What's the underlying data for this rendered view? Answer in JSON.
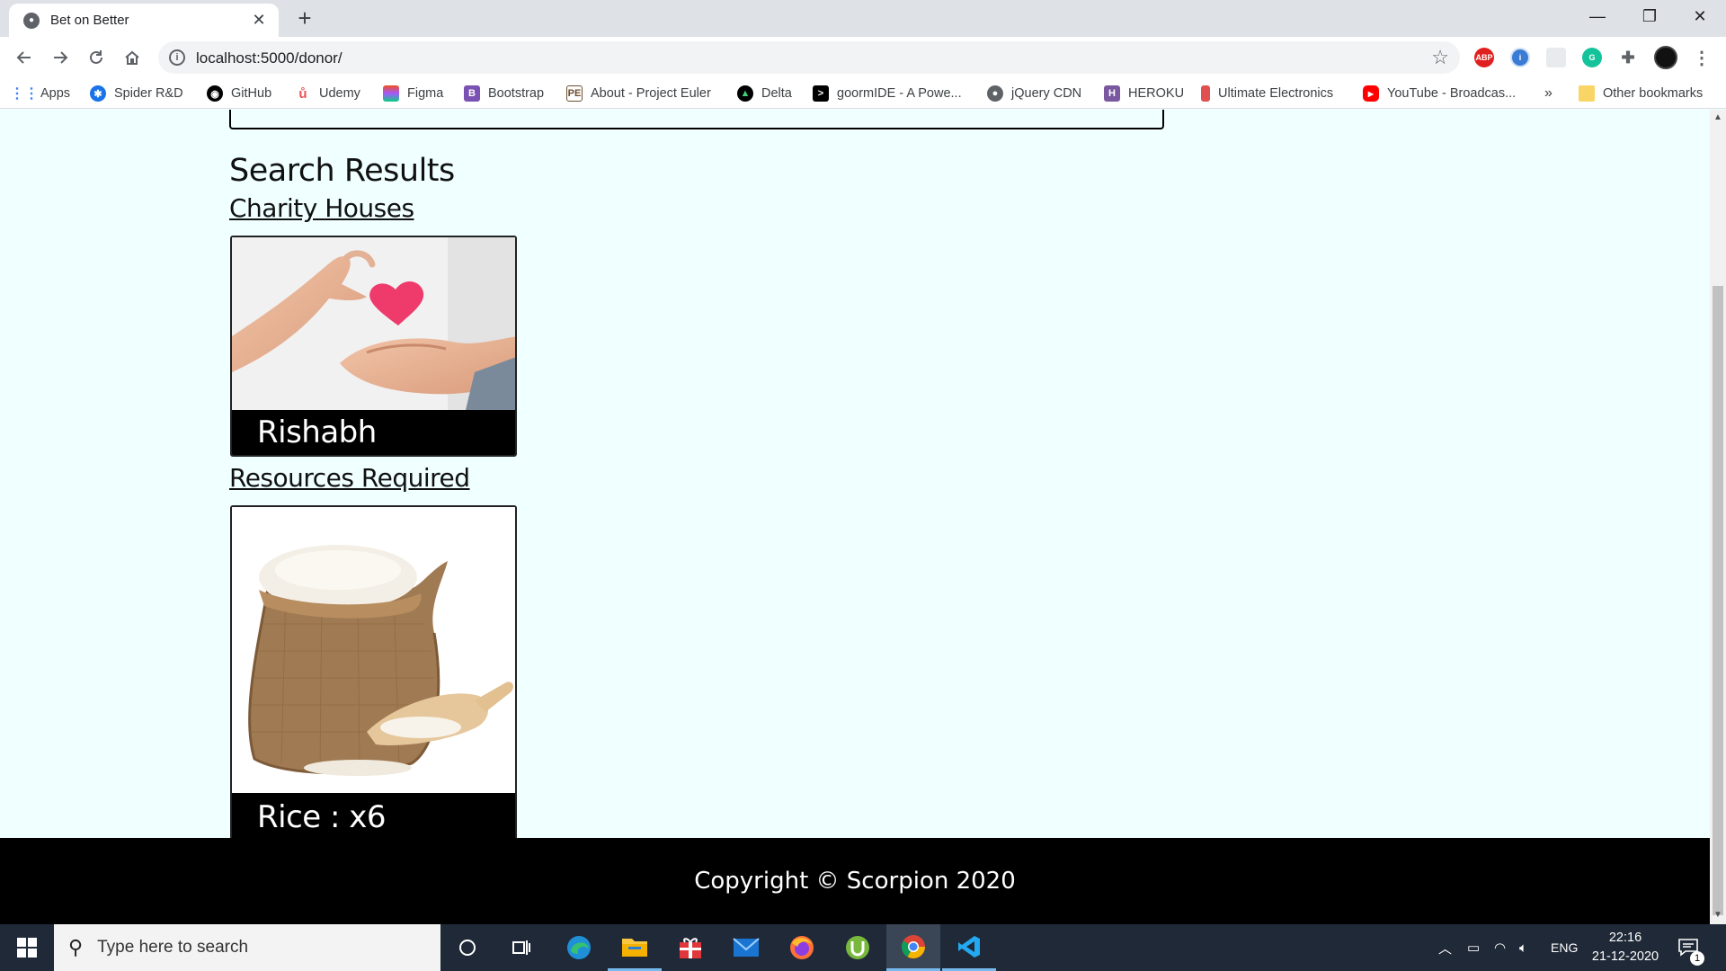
{
  "browser": {
    "tab_title": "Bet on Better",
    "tab_close": "✕",
    "new_tab": "+",
    "url": "localhost:5000/donor/",
    "window_controls": {
      "minimize": "—",
      "maximize": "❐",
      "close": "✕"
    }
  },
  "bookmarks": [
    {
      "label": "Apps",
      "icon": "apps-icon",
      "color": "#4285f4"
    },
    {
      "label": "Spider R&D",
      "icon": "spider-icon",
      "color": "#1a73e8"
    },
    {
      "label": "GitHub",
      "icon": "github-icon",
      "color": "#000000"
    },
    {
      "label": "Udemy",
      "icon": "udemy-icon",
      "color": "#ec5252"
    },
    {
      "label": "Figma",
      "icon": "figma-icon",
      "color": "#f24e1e"
    },
    {
      "label": "Bootstrap",
      "icon": "bootstrap-icon",
      "color": "#7952b3"
    },
    {
      "label": "About - Project Euler",
      "icon": "euler-icon",
      "color": "#6b4e2e"
    },
    {
      "label": "Delta",
      "icon": "delta-icon",
      "color": "#000000"
    },
    {
      "label": "goormIDE - A Powe...",
      "icon": "terminal-icon",
      "color": "#000000"
    },
    {
      "label": "jQuery CDN",
      "icon": "globe-icon",
      "color": "#5f6368"
    },
    {
      "label": "HEROKU",
      "icon": "heroku-icon",
      "color": "#79589f"
    },
    {
      "label": "Ultimate Electronics",
      "icon": "bookmark-icon",
      "color": "#e05050"
    },
    {
      "label": "YouTube - Broadcas...",
      "icon": "youtube-icon",
      "color": "#ff0000"
    }
  ],
  "bookmarks_overflow": "»",
  "other_bookmarks": "Other bookmarks",
  "page": {
    "heading": "Search Results",
    "charity_section": "Charity Houses",
    "charity_cards": [
      {
        "name": "Rishabh"
      }
    ],
    "resources_section": "Resources Required",
    "resource_cards": [
      {
        "label": "Rice : x6"
      }
    ],
    "footer": "Copyright © Scorpion 2020"
  },
  "taskbar": {
    "search_placeholder": "Type here to search",
    "tray_lang": "ENG",
    "time": "22:16",
    "date": "21-12-2020",
    "notification_count": "1"
  },
  "colors": {
    "page_bg": "#f0ffff",
    "footer_bg": "#000000",
    "taskbar_bg": "#1f2937"
  }
}
